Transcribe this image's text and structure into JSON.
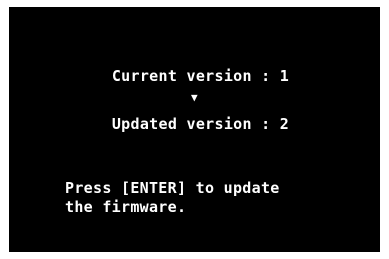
{
  "screen": {
    "current_version_text": "Current version : 1",
    "arrow_glyph": "▼",
    "updated_version_text": "Updated version : 2",
    "instruction_line_1": "Press [ENTER] to update",
    "instruction_line_2": "the firmware."
  },
  "colors": {
    "background": "#000000",
    "text": "#ffffff"
  },
  "icons": [
    "arrow-down-icon"
  ]
}
